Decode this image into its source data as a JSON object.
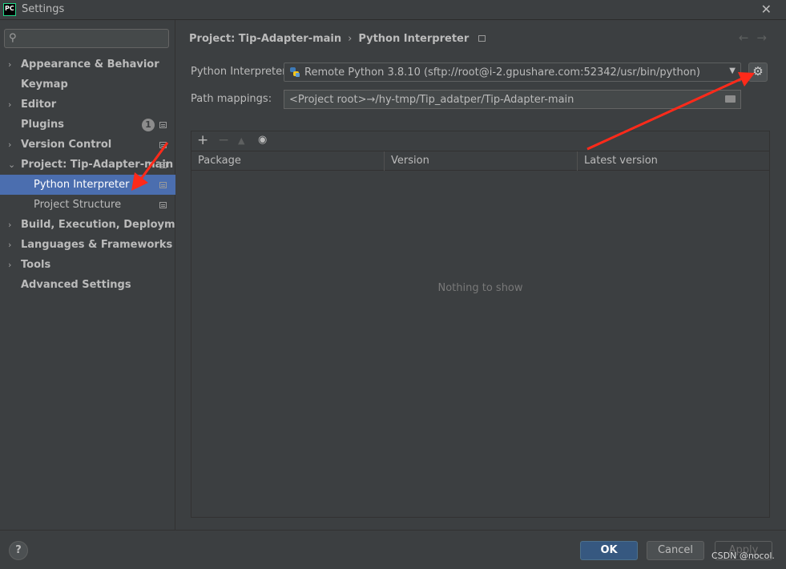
{
  "window": {
    "title": "Settings",
    "logo_text_top": "PC",
    "logo_text_bottom": ""
  },
  "search": {
    "placeholder": "",
    "value": ""
  },
  "sidebar": {
    "items": [
      {
        "label": "Appearance & Behavior",
        "chevron": "›"
      },
      {
        "label": "Keymap"
      },
      {
        "label": "Editor",
        "chevron": "›"
      },
      {
        "label": "Plugins",
        "badge": "1"
      },
      {
        "label": "Version Control",
        "chevron": "›"
      },
      {
        "label": "Project: Tip-Adapter-main",
        "chevron": "⌄"
      },
      {
        "label": "Python Interpreter"
      },
      {
        "label": "Project Structure"
      },
      {
        "label": "Build, Execution, Deployment",
        "chevron": "›"
      },
      {
        "label": "Languages & Frameworks",
        "chevron": "›"
      },
      {
        "label": "Tools",
        "chevron": "›"
      },
      {
        "label": "Advanced Settings"
      }
    ]
  },
  "breadcrumb": {
    "parent": "Project: Tip-Adapter-main",
    "separator": "›",
    "current": "Python Interpreter"
  },
  "nav_arrows": {
    "back": "←",
    "forward": "→"
  },
  "interpreter": {
    "label": "Python Interpreter:",
    "value": "Remote Python 3.8.10 (sftp://root@i-2.gpushare.com:52342/usr/bin/python)"
  },
  "path_mappings": {
    "label": "Path mappings:",
    "value": "<Project root>→/hy-tmp/Tip_adatper/Tip-Adapter-main"
  },
  "packages": {
    "toolbar": {
      "add": "+",
      "remove": "−",
      "upgrade": "▲",
      "show": "◉"
    },
    "columns": [
      "Package",
      "Version",
      "Latest version"
    ],
    "empty_text": "Nothing to show"
  },
  "footer": {
    "help": "?",
    "ok": "OK",
    "cancel": "Cancel",
    "apply": "Apply",
    "watermark": "CSDN @nocol."
  },
  "colors": {
    "selection": "#4b6eaf",
    "arrow": "#ff2a1a",
    "ok_button": "#365880"
  },
  "icons": [
    "search-icon",
    "chevron-right-icon",
    "chevron-down-icon",
    "project-config-icon",
    "python-icon",
    "dropdown-caret-icon",
    "gear-icon",
    "folder-icon",
    "add-icon",
    "remove-icon",
    "upgrade-icon",
    "eye-icon",
    "help-icon",
    "close-icon"
  ]
}
